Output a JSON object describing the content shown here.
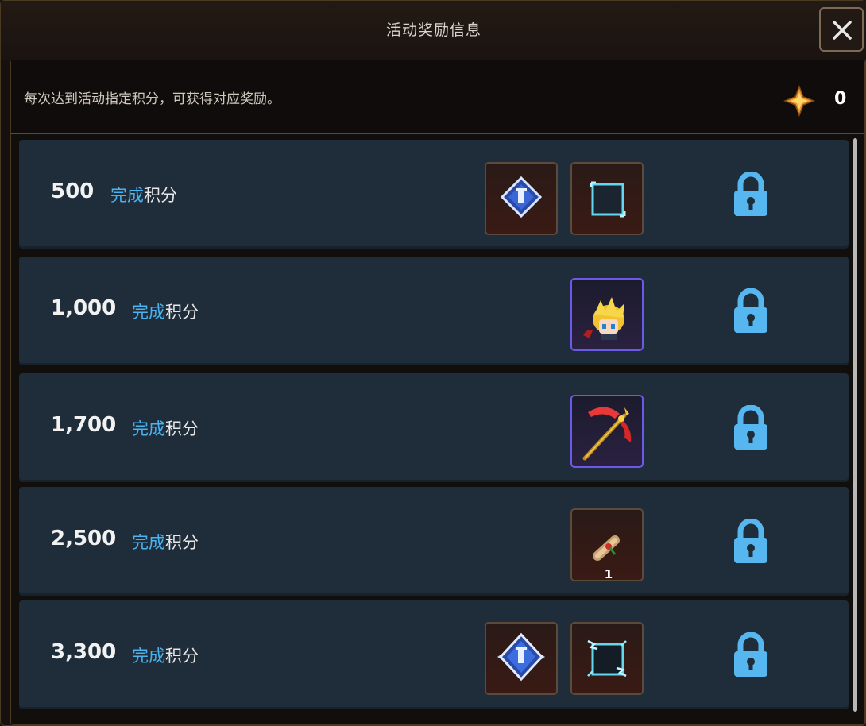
{
  "window": {
    "title": "活动奖励信息"
  },
  "info": {
    "description": "每次达到活动指定积分，可获得对应奖励。",
    "points": "0"
  },
  "colors": {
    "accent": "#4ab3f0",
    "row_bg": "#1e2d39",
    "lock": "#55b6f0"
  },
  "rows": [
    {
      "score": "500",
      "complete_prefix": "完成",
      "complete_suffix": "积分",
      "rewards": [
        "blue-badge-icon",
        "cyan-frame-icon"
      ],
      "locked": true
    },
    {
      "score": "1,000",
      "complete_prefix": "完成",
      "complete_suffix": "积分",
      "rewards": [
        "character-portrait-icon"
      ],
      "locked": true
    },
    {
      "score": "1,700",
      "complete_prefix": "完成",
      "complete_suffix": "积分",
      "rewards": [
        "red-axe-weapon-icon"
      ],
      "locked": true
    },
    {
      "score": "2,500",
      "complete_prefix": "完成",
      "complete_suffix": "积分",
      "rewards": [
        "scroll-item-icon"
      ],
      "reward_qty": "1",
      "locked": true
    },
    {
      "score": "3,300",
      "complete_prefix": "完成",
      "complete_suffix": "积分",
      "rewards": [
        "blue-badge-winged-icon",
        "electric-frame-icon"
      ],
      "locked": true
    }
  ]
}
